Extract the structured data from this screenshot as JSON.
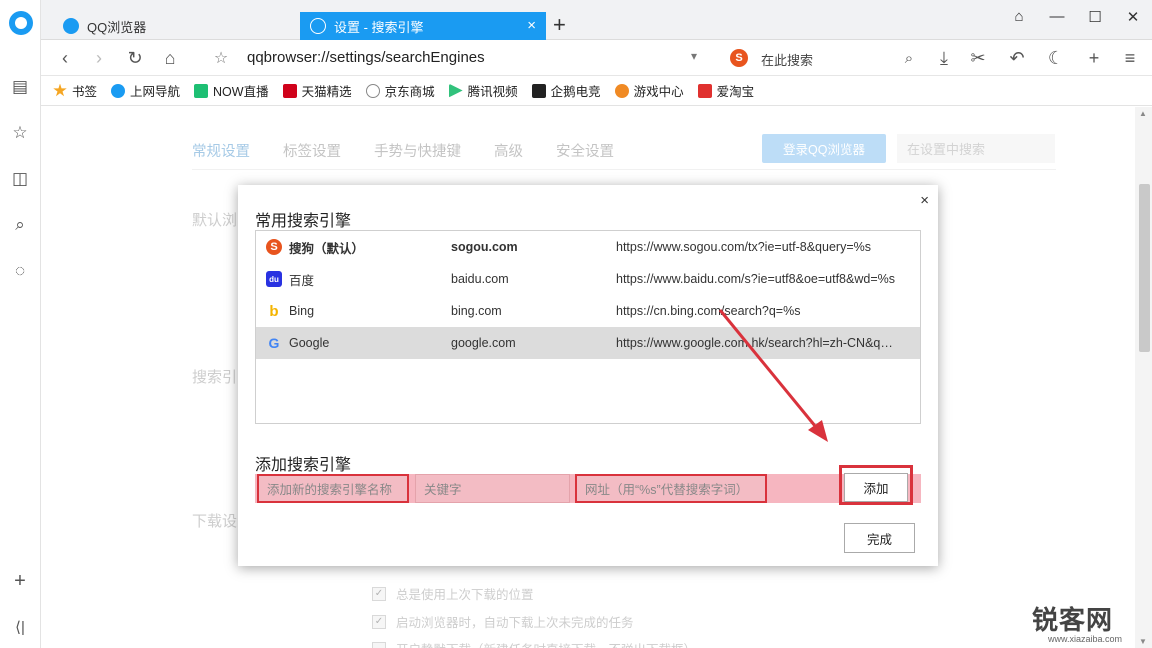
{
  "tabs": [
    {
      "title": "QQ浏览器"
    },
    {
      "title": "设置 - 搜索引擎"
    }
  ],
  "toolbar": {
    "address": "qqbrowser://settings/searchEngines",
    "search_placeholder": "在此搜索",
    "search_engine_icon_letter": "S"
  },
  "bookmarks": [
    {
      "label": "书签",
      "color": "#f5a623"
    },
    {
      "label": "上网导航",
      "color": "#1a9bf2"
    },
    {
      "label": "NOW直播",
      "color": "#1dbf73"
    },
    {
      "label": "天猫精选",
      "color": "#d0021b"
    },
    {
      "label": "京东商城",
      "color": "#888888"
    },
    {
      "label": "腾讯视频",
      "color": "#31c27c"
    },
    {
      "label": "企鹅电竞",
      "color": "#222222"
    },
    {
      "label": "游戏中心",
      "color": "#f08a24"
    },
    {
      "label": "爱淘宝",
      "color": "#e0312f"
    }
  ],
  "settings": {
    "tabs": [
      "常规设置",
      "标签设置",
      "手势与快捷键",
      "高级",
      "安全设置"
    ],
    "active_tab": "常规设置",
    "login_button": "登录QQ浏览器",
    "search_placeholder": "在设置中搜索",
    "sections": {
      "default_browser": "默认浏",
      "search_engine": "搜索引",
      "download": "下载设"
    },
    "download_options": [
      {
        "label": "总是使用上次下载的位置",
        "checked": true
      },
      {
        "label": "启动浏览器时，自动下载上次未完成的任务",
        "checked": true
      },
      {
        "label": "开启静默下载（新建任务时直接下载，不弹出下载框）",
        "checked": false
      }
    ]
  },
  "dialog": {
    "title": "常用搜索引擎",
    "engines": [
      {
        "name": "搜狗（默认）",
        "keyword": "sogou.com",
        "url": "https://www.sogou.com/tx?ie=utf-8&query=%s",
        "icon": "S",
        "icon_color": "#e8541e",
        "bold": true,
        "selected": false
      },
      {
        "name": "百度",
        "keyword": "baidu.com",
        "url": "https://www.baidu.com/s?ie=utf8&oe=utf8&wd=%s",
        "icon": "du",
        "icon_color": "#2932e1",
        "bold": false,
        "selected": false
      },
      {
        "name": "Bing",
        "keyword": "bing.com",
        "url": "https://cn.bing.com/search?q=%s",
        "icon": "b",
        "icon_color": "#f4b400",
        "bold": false,
        "selected": false
      },
      {
        "name": "Google",
        "keyword": "google.com",
        "url": "https://www.google.com.hk/search?hl=zh-CN&q=...",
        "icon": "G",
        "icon_color": "#4285f4",
        "bold": false,
        "selected": true
      }
    ],
    "add_title": "添加搜索引擎",
    "add_name_placeholder": "添加新的搜索引擎名称",
    "add_keyword_placeholder": "关键字",
    "add_url_placeholder": "网址（用“%s”代替搜索字词）",
    "add_button": "添加",
    "done_button": "完成",
    "close": "×"
  },
  "watermark": {
    "text": "锐客网",
    "url": "www.xiazaiba.com"
  },
  "colors": {
    "accent": "#1a9bf2",
    "highlight_red": "#d9323c"
  }
}
